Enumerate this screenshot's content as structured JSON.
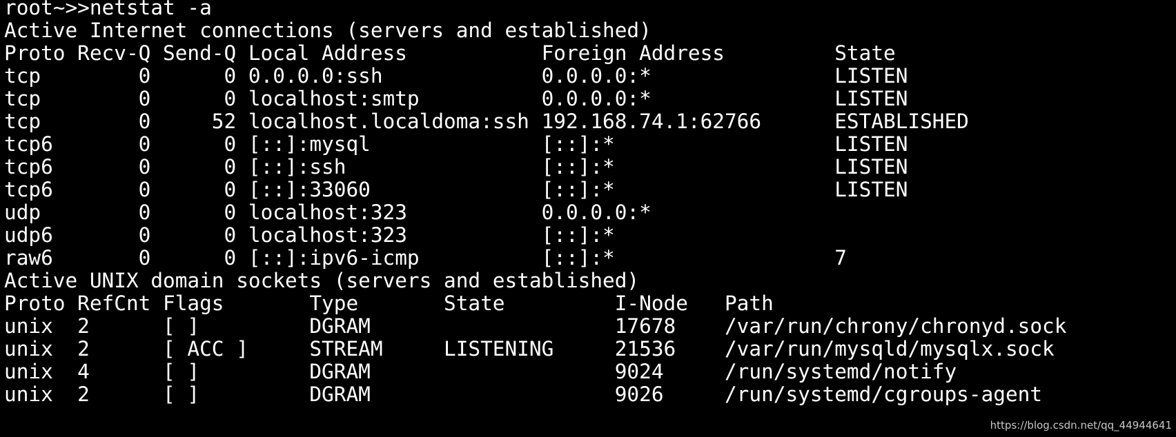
{
  "terminal": {
    "prompt": "root~>>",
    "command": "netstat -a",
    "lines": [
      "Active Internet connections (servers and established)",
      "Proto Recv-Q Send-Q Local Address           Foreign Address         State",
      "tcp        0      0 0.0.0.0:ssh             0.0.0.0:*               LISTEN",
      "tcp        0      0 localhost:smtp          0.0.0.0:*               LISTEN",
      "tcp        0     52 localhost.localdoma:ssh 192.168.74.1:62766      ESTABLISHED",
      "tcp6       0      0 [::]:mysql              [::]:*                  LISTEN",
      "tcp6       0      0 [::]:ssh                [::]:*                  LISTEN",
      "tcp6       0      0 [::]:33060              [::]:*                  LISTEN",
      "udp        0      0 localhost:323           0.0.0.0:*",
      "udp6       0      0 localhost:323           [::]:*",
      "raw6       0      0 [::]:ipv6-icmp          [::]:*                  7",
      "Active UNIX domain sockets (servers and established)",
      "Proto RefCnt Flags       Type       State         I-Node   Path",
      "unix  2      [ ]         DGRAM                    17678    /var/run/chrony/chronyd.sock",
      "unix  2      [ ACC ]     STREAM     LISTENING     21536    /var/run/mysqld/mysqlx.sock",
      "unix  4      [ ]         DGRAM                    9024     /run/systemd/notify",
      "unix  2      [ ]         DGRAM                    9026     /run/systemd/cgroups-agent"
    ]
  },
  "watermark": "https://blog.csdn.net/qq_44944641",
  "colors": {
    "background": "#000000",
    "text": "#ffffff"
  }
}
